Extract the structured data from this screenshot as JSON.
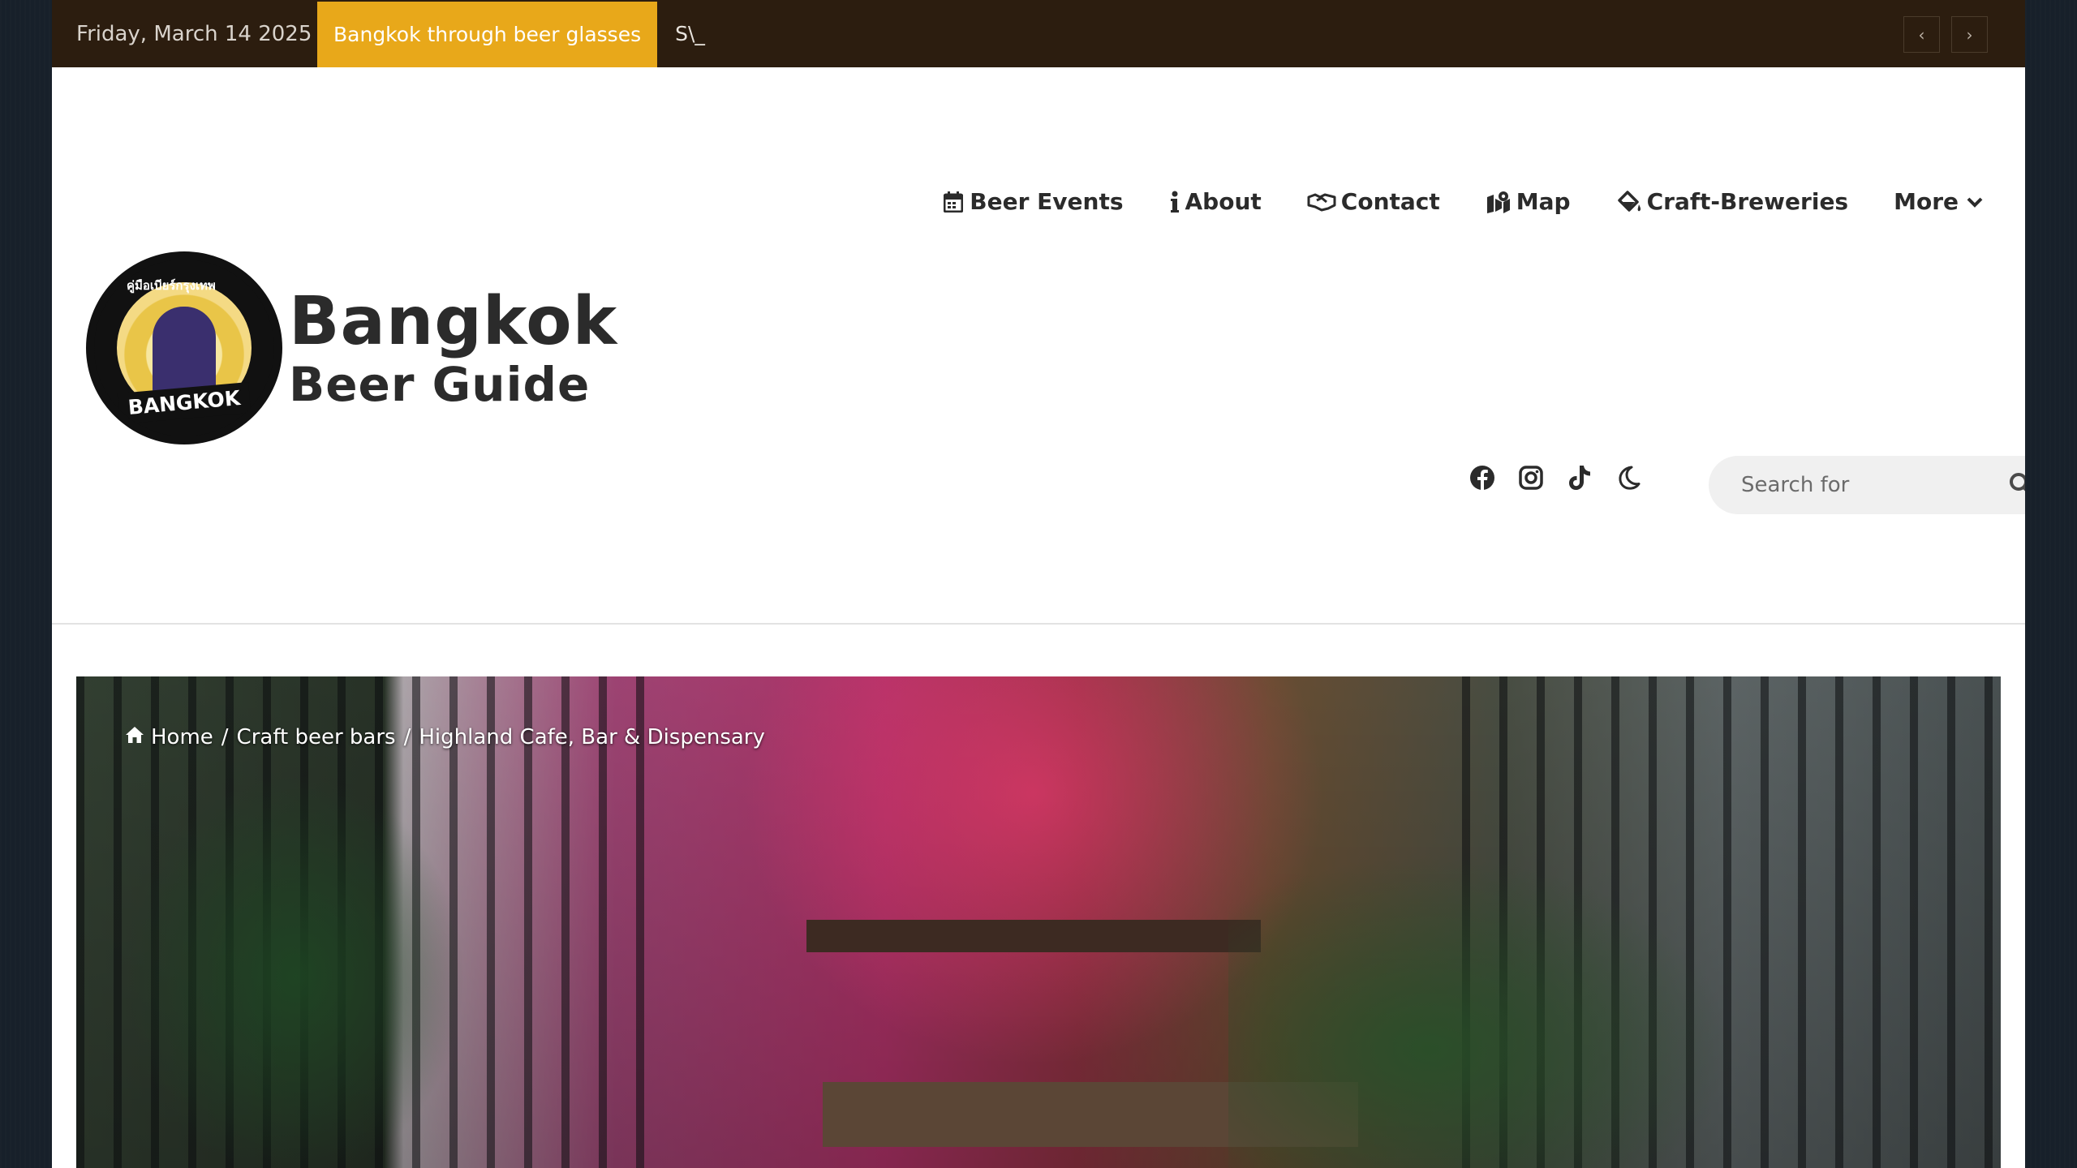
{
  "topbar": {
    "date": "Friday, March 14 2025",
    "breaking_label": "Bangkok through beer glasses",
    "ticker_text": "S\\_",
    "prev_glyph": "‹",
    "next_glyph": "›"
  },
  "logo": {
    "line1": "Bangkok",
    "line2": "Beer Guide",
    "badge_text": "BANGKOK",
    "badge_arc_text": "คู่มือเบียร์กรุงเทพ"
  },
  "nav": {
    "items": [
      {
        "label": "Beer Events",
        "icon": "calendar-icon"
      },
      {
        "label": "About",
        "icon": "info-icon"
      },
      {
        "label": "Contact",
        "icon": "handshake-icon"
      },
      {
        "label": "Map",
        "icon": "map-icon"
      },
      {
        "label": "Craft-Breweries",
        "icon": "paint-bucket-icon"
      },
      {
        "label": "More",
        "icon": "chevron-down-icon"
      }
    ]
  },
  "social": {
    "icons": [
      "facebook-icon",
      "instagram-icon",
      "tiktok-icon",
      "dark-mode-moon-icon"
    ]
  },
  "search": {
    "placeholder": "Search for"
  },
  "breadcrumb": {
    "home": "Home",
    "sep": "/",
    "category": "Craft beer bars",
    "current": "Highland Cafe, Bar & Dispensary"
  },
  "colors": {
    "topbar_bg": "#2c1d0f",
    "accent": "#e8a81a",
    "text_dark": "#2b2b2b",
    "page_bg": "#17202a"
  }
}
